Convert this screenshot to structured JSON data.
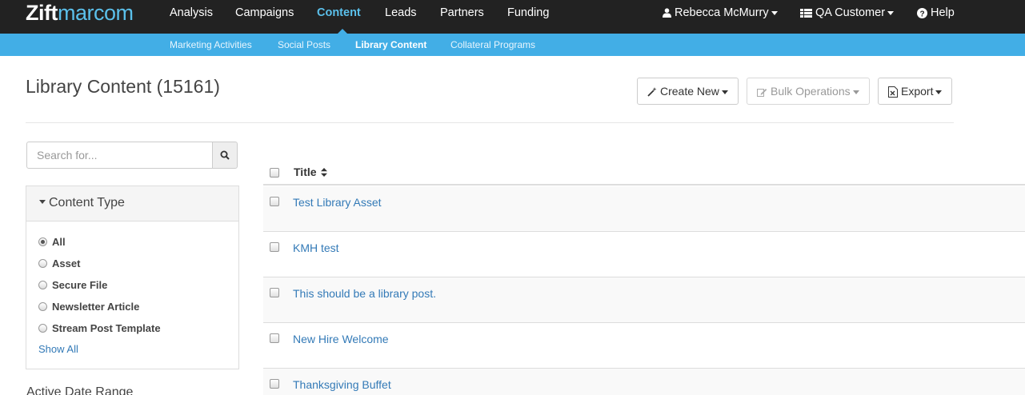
{
  "brand": {
    "bold": "Zift",
    "light": "marcom"
  },
  "topnav": {
    "items": [
      {
        "label": "Analysis"
      },
      {
        "label": "Campaigns"
      },
      {
        "label": "Content"
      },
      {
        "label": "Leads"
      },
      {
        "label": "Partners"
      },
      {
        "label": "Funding"
      }
    ],
    "active": "Content",
    "user": "Rebecca McMurry",
    "account": "QA Customer",
    "help": "Help"
  },
  "subnav": {
    "items": [
      {
        "label": "Marketing Activities"
      },
      {
        "label": "Social Posts"
      },
      {
        "label": "Library Content"
      },
      {
        "label": "Collateral Programs"
      }
    ],
    "active": "Library Content"
  },
  "header": {
    "title": "Library Content (15161)",
    "create_new": "Create New",
    "bulk_operations": "Bulk Operations",
    "export": "Export"
  },
  "search": {
    "placeholder": "Search for..."
  },
  "filter": {
    "heading": "Content Type",
    "options": [
      {
        "label": "All",
        "selected": true
      },
      {
        "label": "Asset",
        "selected": false
      },
      {
        "label": "Secure File",
        "selected": false
      },
      {
        "label": "Newsletter Article",
        "selected": false
      },
      {
        "label": "Stream Post Template",
        "selected": false
      }
    ],
    "show_all": "Show All"
  },
  "next_section": "Active Date Range",
  "table": {
    "column": "Title",
    "rows": [
      {
        "title": "Test Library Asset"
      },
      {
        "title": "KMH test"
      },
      {
        "title": "This should be a library post."
      },
      {
        "title": "New Hire Welcome"
      },
      {
        "title": "Thanksgiving Buffet"
      }
    ]
  },
  "colors": {
    "nav_bg": "#222222",
    "accent": "#42aee6",
    "link": "#337ab7"
  }
}
